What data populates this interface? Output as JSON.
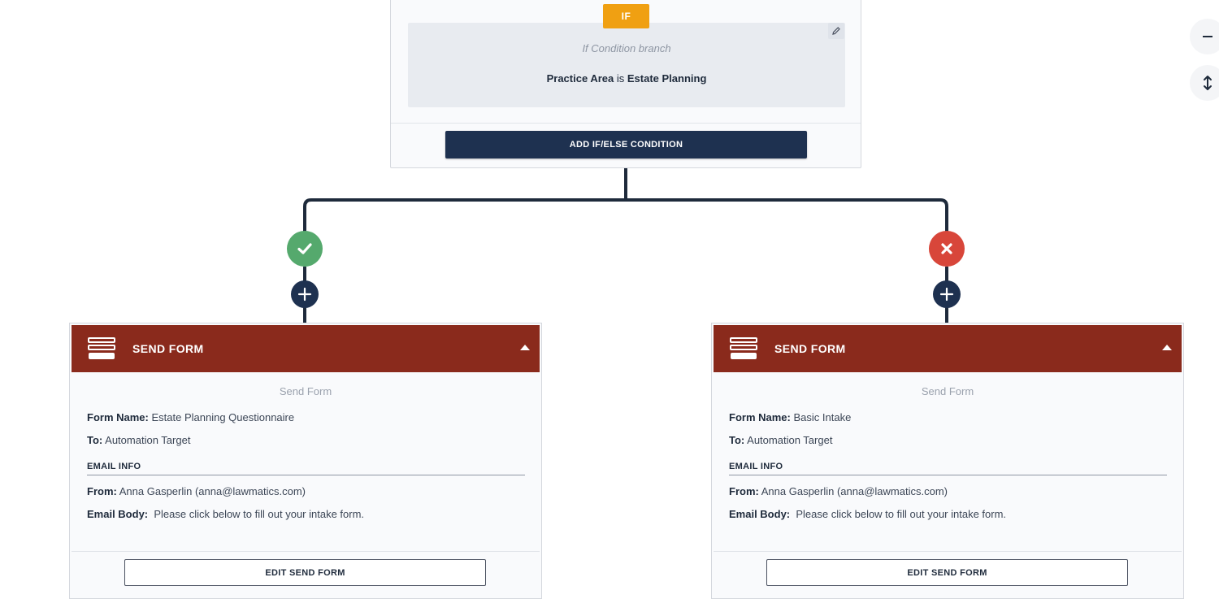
{
  "if_node": {
    "badge": "IF",
    "branch_title": "If Condition branch",
    "condition": {
      "field": "Practice Area",
      "operator": "is",
      "value": "Estate Planning"
    },
    "add_condition_label": "ADD IF/ELSE CONDITION"
  },
  "branches": [
    {
      "result": "true",
      "result_icon": "check-icon",
      "result_color": "#55a96d",
      "card": {
        "header": "SEND FORM",
        "subtitle": "Send Form",
        "form_name_label": "Form Name:",
        "form_name": "Estate Planning Questionnaire",
        "to_label": "To:",
        "to": "Automation Target",
        "email_info_label": "EMAIL INFO",
        "from_label": "From:",
        "from": "Anna Gasperlin (anna@lawmatics.com)",
        "email_body_label": "Email Body:",
        "email_body": "Please click below to fill out your intake form.",
        "edit_label": "EDIT SEND FORM"
      }
    },
    {
      "result": "false",
      "result_icon": "x-icon",
      "result_color": "#d8463a",
      "card": {
        "header": "SEND FORM",
        "subtitle": "Send Form",
        "form_name_label": "Form Name:",
        "form_name": "Basic Intake",
        "to_label": "To:",
        "to": "Automation Target",
        "email_info_label": "EMAIL INFO",
        "from_label": "From:",
        "from": "Anna Gasperlin (anna@lawmatics.com)",
        "email_body_label": "Email Body:",
        "email_body": "Please click below to fill out your intake form.",
        "edit_label": "EDIT SEND FORM"
      }
    }
  ],
  "colors": {
    "card_header": "#8a2a1c",
    "navy": "#1e3150",
    "if_badge": "#f0a012"
  }
}
